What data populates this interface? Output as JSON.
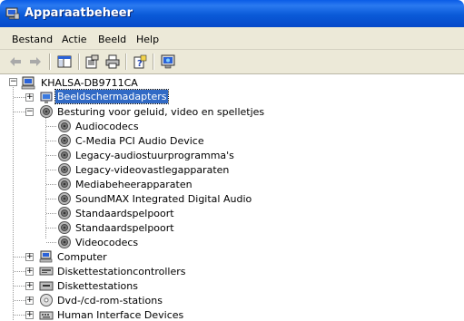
{
  "window": {
    "title": "Apparaatbeheer"
  },
  "menu": [
    "Bestand",
    "Actie",
    "Beeld",
    "Help"
  ],
  "toolbar": {
    "buttons": [
      "back-arrow-icon",
      "forward-arrow-icon",
      "show-hide-console-tree-icon",
      "properties-icon",
      "print-icon",
      "help-icon",
      "scan-hardware-icon"
    ]
  },
  "tree": {
    "root": "KHALSA-DB9711CA",
    "display_adapters": "Beeldschermadapters",
    "sound_category": "Besturing voor geluid, video en spelletjes",
    "sound_children": [
      "Audiocodecs",
      "C-Media PCI Audio Device",
      "Legacy-audiostuurprogramma's",
      "Legacy-videovastlegapparaten",
      "Mediabeheerapparaten",
      "SoundMAX Integrated Digital Audio",
      "Standaardspelpoort",
      "Standaardspelpoort",
      "Videocodecs"
    ],
    "computer": "Computer",
    "floppy_controllers": "Diskettestationcontrollers",
    "floppy_drives": "Diskettestations",
    "dvd_cd": "Dvd-/cd-rom-stations",
    "hid": "Human Interface Devices"
  },
  "colors": {
    "title_bar": "#0a5ce6",
    "selection": "#316ac5",
    "chrome": "#ece9d8"
  }
}
